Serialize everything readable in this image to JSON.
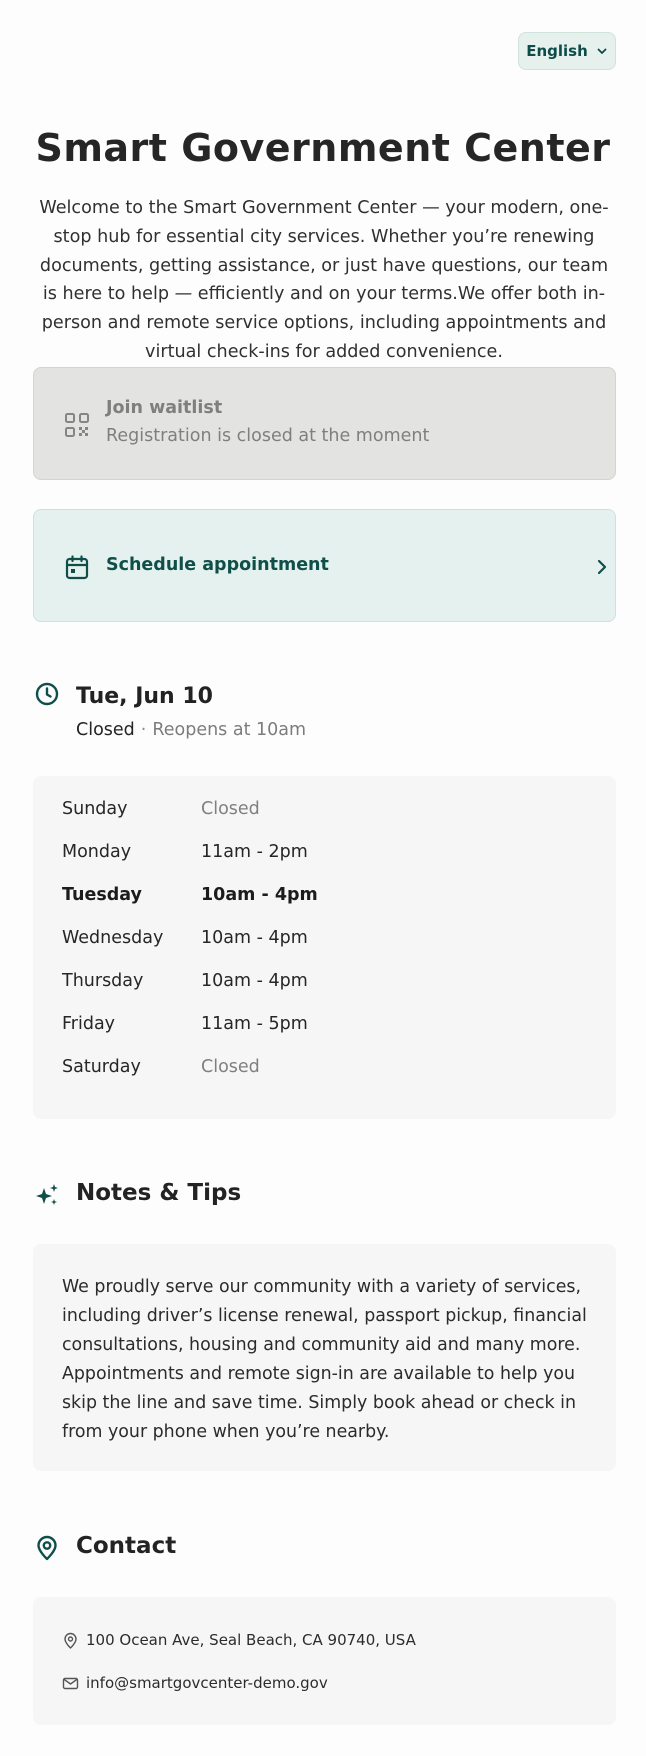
{
  "header": {
    "language_label": "English"
  },
  "hero": {
    "title": "Smart Government Center",
    "intro": "Welcome to the Smart Government Center — your modern, one-stop hub for essential city services. Whether you’re renewing documents, getting assistance, or just have questions, our team is here to help — efficiently and on your terms.We offer both in-person and remote service options, including appointments and virtual check-ins for added convenience."
  },
  "waitlist": {
    "title": "Join waitlist",
    "subtitle": "Registration is closed at the moment",
    "icon": "qr-code-icon",
    "enabled": false
  },
  "schedule": {
    "label": "Schedule appointment",
    "icon": "calendar-icon"
  },
  "today": {
    "date": "Tue, Jun 10",
    "status": "Closed",
    "separator": "·",
    "reopens": "Reopens at 10am"
  },
  "hours": [
    {
      "day": "Sunday",
      "time": "Closed",
      "closed": true,
      "today": false
    },
    {
      "day": "Monday",
      "time": "11am - 2pm",
      "closed": false,
      "today": false
    },
    {
      "day": "Tuesday",
      "time": "10am - 4pm",
      "closed": false,
      "today": true
    },
    {
      "day": "Wednesday",
      "time": "10am - 4pm",
      "closed": false,
      "today": false
    },
    {
      "day": "Thursday",
      "time": "10am - 4pm",
      "closed": false,
      "today": false
    },
    {
      "day": "Friday",
      "time": "11am - 5pm",
      "closed": false,
      "today": false
    },
    {
      "day": "Saturday",
      "time": "Closed",
      "closed": true,
      "today": false
    }
  ],
  "notes": {
    "title": "Notes & Tips",
    "text": "We proudly serve our community with a variety of services, including driver’s license renewal, passport pickup, financial consultations, housing and community aid and many more. Appointments and remote sign-in are available to help you skip the line and save time. Simply book ahead or check in from your phone when you’re nearby."
  },
  "contact": {
    "title": "Contact",
    "address": "100 Ocean Ave, Seal Beach, CA 90740, USA",
    "email": "info@smartgovcenter-demo.gov"
  },
  "colors": {
    "accent": "#0d4c48",
    "accent_bg": "#e5f1ee",
    "disabled_bg": "#e3e3e1",
    "panel_bg": "#f6f6f6"
  }
}
